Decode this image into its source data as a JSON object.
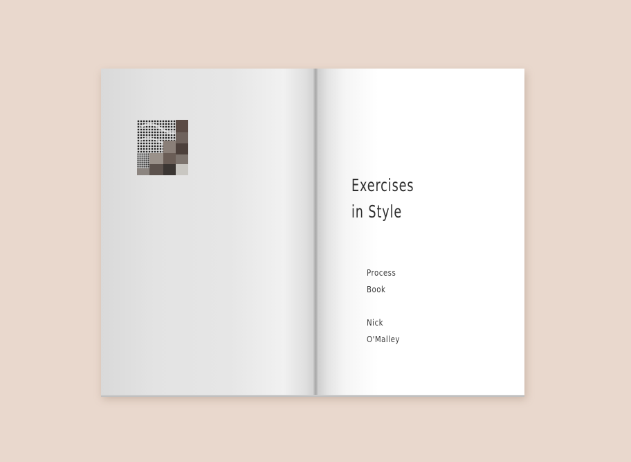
{
  "book": {
    "title_lines": [
      "Exercises",
      "in Style"
    ],
    "subtitle_lines": [
      "Process",
      "Book"
    ],
    "author_lines": [
      "Nick",
      "O'Malley"
    ]
  },
  "colors": {
    "background": "#e9d8cd",
    "page": "#ffffff",
    "text": "#2e2e2e"
  }
}
